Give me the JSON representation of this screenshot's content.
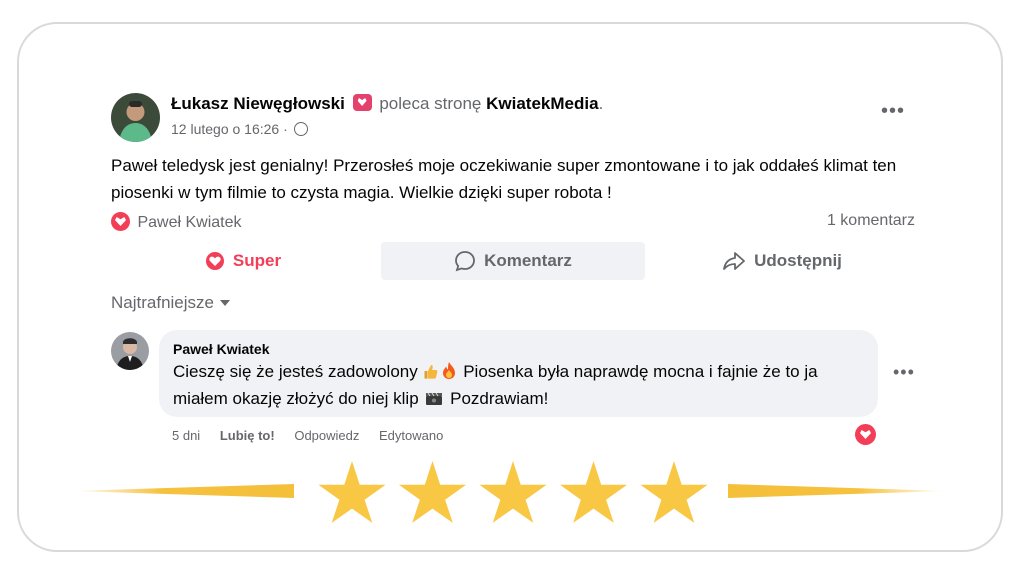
{
  "post": {
    "author": "Łukasz Niewęgłowski",
    "action_text": "poleca stronę",
    "page_name": "KwiatekMedia",
    "page_suffix": ".",
    "date": "12 lutego o 16:26 ·",
    "more_label": "•••",
    "text": "Paweł teledysk jest genialny! Przerosłeś moje oczekiwanie super zmontowane i to jak oddałeś klimat ten piosenki w  tym filmie to czysta magia. Wielkie dzięki super robota !",
    "reactor": "Paweł Kwiatek",
    "comment_count": "1 komentarz"
  },
  "actions": {
    "super": "Super",
    "comment": "Komentarz",
    "share": "Udostępnij"
  },
  "sort_label": "Najtrafniejsze",
  "comment": {
    "author": "Paweł Kwiatek",
    "text_part1": "Cieszę się że jesteś zadowolony",
    "text_part2": "Piosenka była naprawdę mocna i fajnie że to ja miałem okazję złożyć do niej klip",
    "text_part3": "Pozdrawiam!",
    "more_label": "•••",
    "time": "5 dni",
    "like": "Lubię to!",
    "reply": "Odpowiedz",
    "edited": "Edytowano"
  },
  "rating": {
    "value": 5,
    "max": 5
  },
  "colors": {
    "accent": "#f33e58",
    "star": "#f8c744",
    "muted": "#65676b",
    "bubble": "#f0f2f5"
  }
}
